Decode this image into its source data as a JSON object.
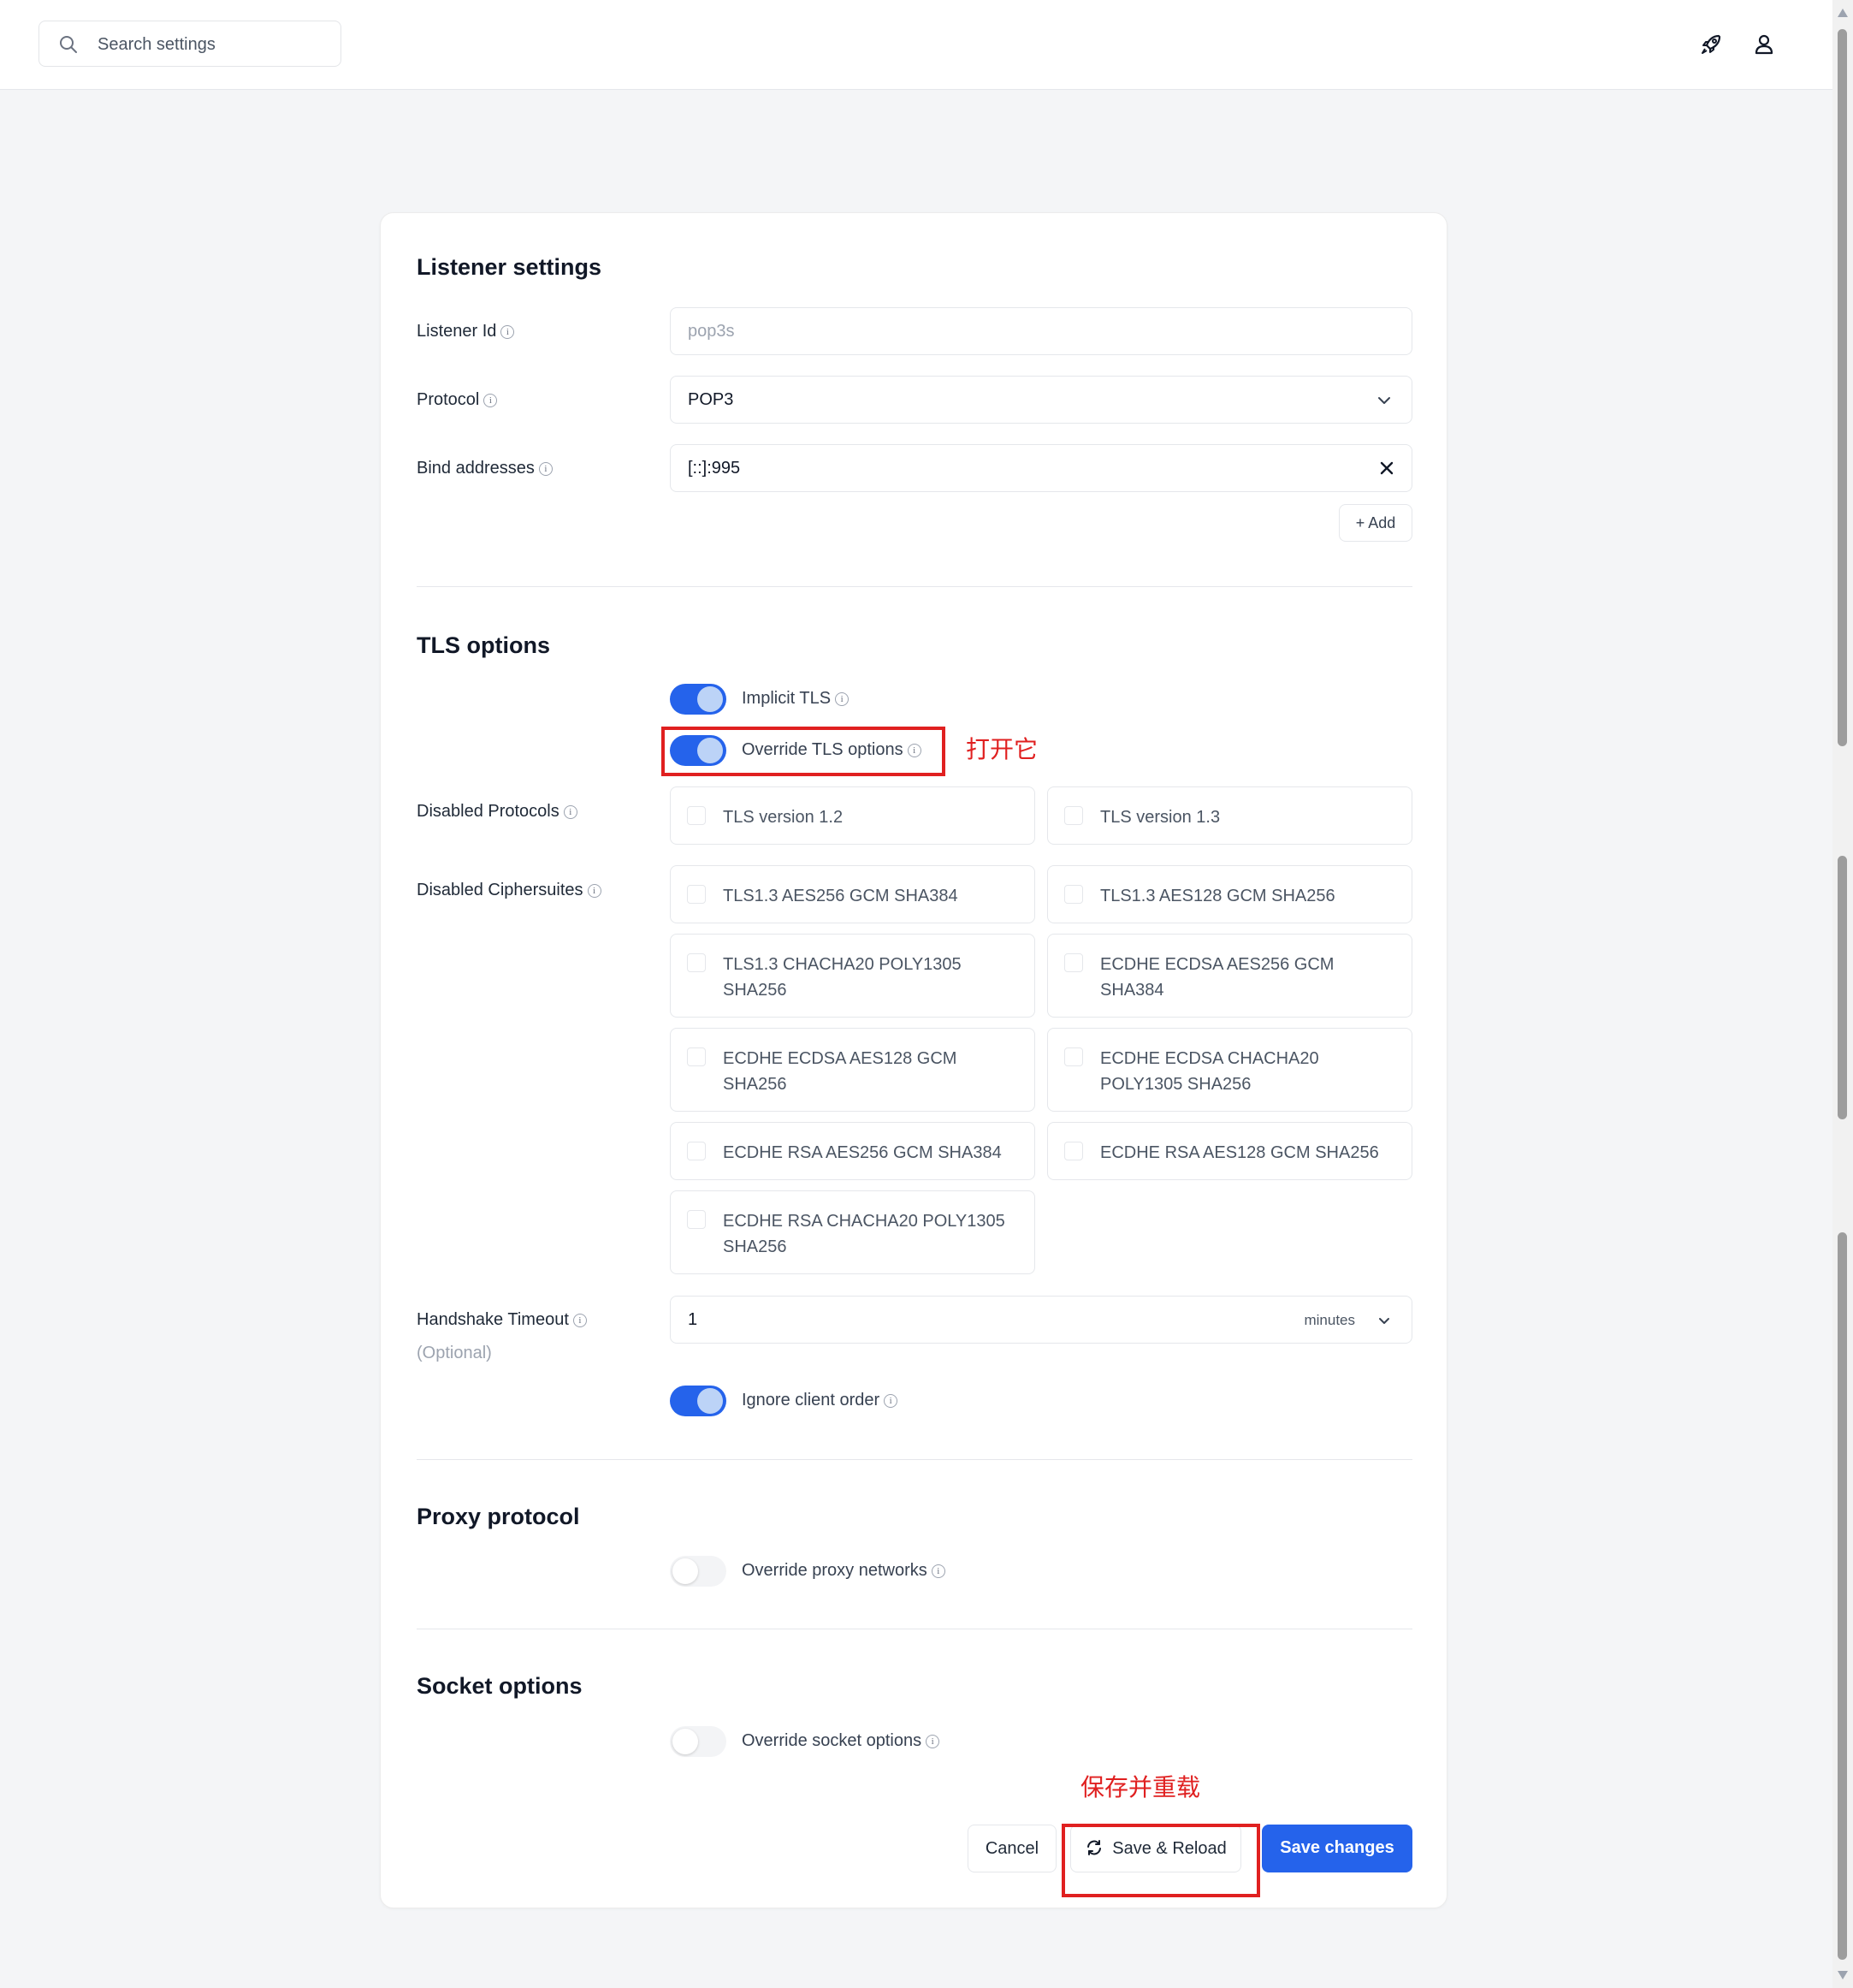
{
  "search": {
    "placeholder": "Search settings"
  },
  "listener": {
    "title": "Listener settings",
    "id_label": "Listener Id",
    "id_value": "pop3s",
    "protocol_label": "Protocol",
    "protocol_value": "POP3",
    "bind_label": "Bind addresses",
    "bind_value": "[::]:995",
    "add_label": "Add"
  },
  "tls": {
    "title": "TLS options",
    "implicit_label": "Implicit TLS",
    "implicit_on": true,
    "override_label": "Override TLS options",
    "override_on": true,
    "protocols_label": "Disabled Protocols",
    "protocols": [
      "TLS version 1.2",
      "TLS version 1.3"
    ],
    "ciphers_label": "Disabled Ciphersuites",
    "ciphers": [
      "TLS1.3 AES256 GCM SHA384",
      "TLS1.3 AES128 GCM SHA256",
      "TLS1.3 CHACHA20 POLY1305 SHA256",
      "ECDHE ECDSA AES256 GCM SHA384",
      "ECDHE ECDSA AES128 GCM SHA256",
      "ECDHE ECDSA CHACHA20 POLY1305 SHA256",
      "ECDHE RSA AES256 GCM SHA384",
      "ECDHE RSA AES128 GCM SHA256",
      "ECDHE RSA CHACHA20 POLY1305 SHA256"
    ],
    "timeout_label": "Handshake Timeout",
    "timeout_optional": "(Optional)",
    "timeout_value": "1",
    "timeout_unit": "minutes",
    "ignore_label": "Ignore client order",
    "ignore_on": true
  },
  "proxy": {
    "title": "Proxy protocol",
    "override_label": "Override proxy networks",
    "override_on": false
  },
  "socket": {
    "title": "Socket options",
    "override_label": "Override socket options",
    "override_on": false
  },
  "buttons": {
    "cancel": "Cancel",
    "reload": "Save & Reload",
    "save": "Save changes"
  },
  "annotations": {
    "turn_on": "打开它",
    "save_reload": "保存并重载",
    "color": "#e02020"
  },
  "colors": {
    "accent": "#2563eb"
  }
}
